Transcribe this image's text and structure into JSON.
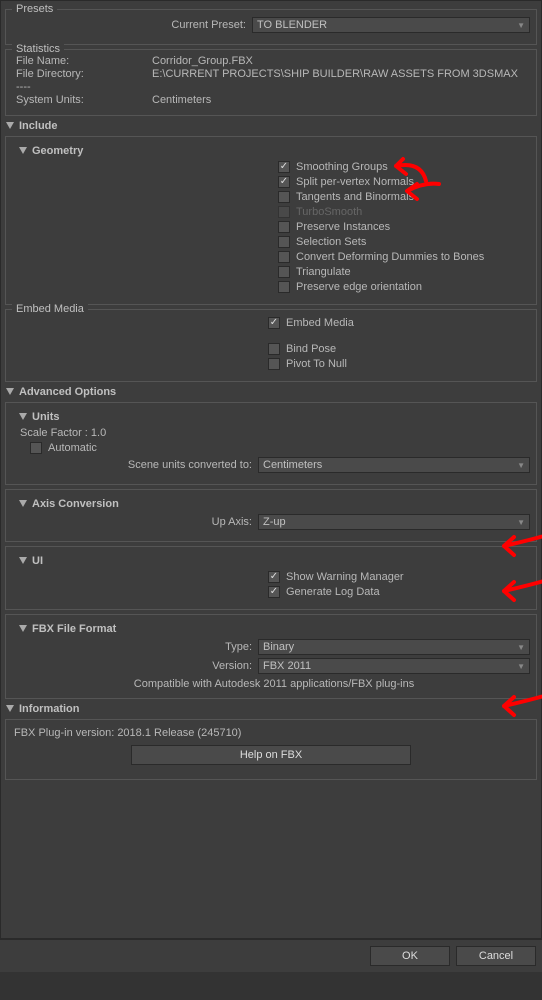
{
  "presets": {
    "title": "Presets",
    "current_label": "Current Preset:",
    "current_value": "TO BLENDER"
  },
  "statistics": {
    "title": "Statistics",
    "file_name_label": "File Name:",
    "file_name_value": "Corridor_Group.FBX",
    "file_dir_label": "File Directory:",
    "file_dir_value": "E:\\CURRENT PROJECTS\\SHIP BUILDER\\RAW ASSETS FROM 3DSMAX",
    "separator": "----",
    "system_units_label": "System Units:",
    "system_units_value": "Centimeters"
  },
  "include": {
    "title": "Include",
    "geometry": {
      "title": "Geometry",
      "smoothing_groups": "Smoothing Groups",
      "split_normals": "Split per-vertex Normals",
      "tangents": "Tangents and Binormals",
      "turbosmooth": "TurboSmooth",
      "preserve_instances": "Preserve Instances",
      "selection_sets": "Selection Sets",
      "convert_dummies": "Convert Deforming Dummies to Bones",
      "triangulate": "Triangulate",
      "preserve_edge": "Preserve edge orientation"
    },
    "embed_media": {
      "title": "Embed Media",
      "embed_media": "Embed Media",
      "bind_pose": "Bind Pose",
      "pivot_to_null": "Pivot To Null"
    }
  },
  "advanced": {
    "title": "Advanced Options",
    "units": {
      "title": "Units",
      "scale_factor": "Scale Factor : 1.0",
      "automatic": "Automatic",
      "scene_units_label": "Scene units converted to:",
      "scene_units_value": "Centimeters"
    },
    "axis": {
      "title": "Axis Conversion",
      "up_axis_label": "Up Axis:",
      "up_axis_value": "Z-up"
    },
    "ui": {
      "title": "UI",
      "show_warning": "Show Warning Manager",
      "generate_log": "Generate Log Data"
    },
    "fbx_format": {
      "title": "FBX File Format",
      "type_label": "Type:",
      "type_value": "Binary",
      "version_label": "Version:",
      "version_value": "FBX 2011",
      "compat_text": "Compatible with Autodesk 2011 applications/FBX plug-ins"
    }
  },
  "information": {
    "title": "Information",
    "plugin_version": "FBX Plug-in version: 2018.1 Release (245710)",
    "help_btn": "Help on FBX"
  },
  "buttons": {
    "ok": "OK",
    "cancel": "Cancel"
  }
}
